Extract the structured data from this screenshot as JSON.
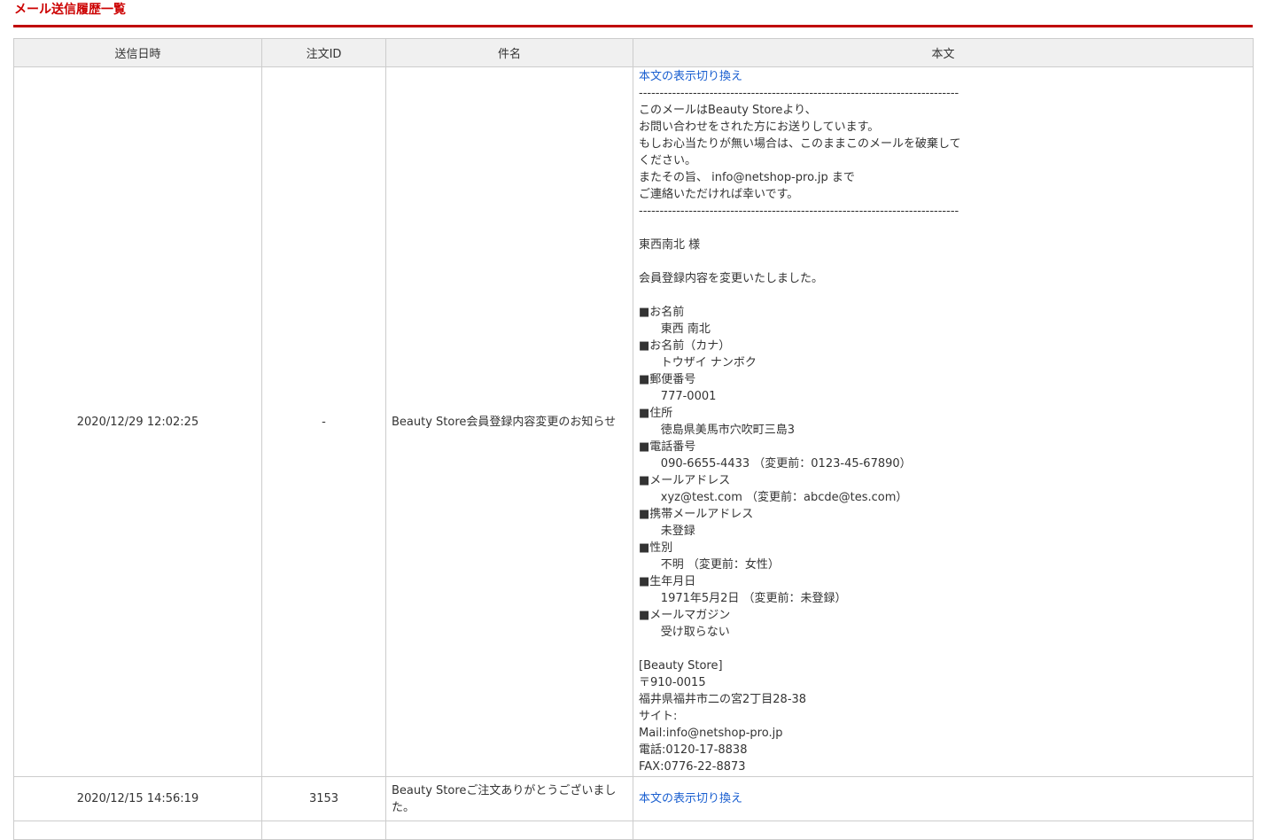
{
  "page": {
    "title": "メール送信履歴一覧"
  },
  "colors": {
    "accent": "#c00000",
    "link": "#1a5fd0",
    "header_bg": "#f0f0f0",
    "border": "#cccccc"
  },
  "table": {
    "headers": {
      "sent_at": "送信日時",
      "order_id": "注文ID",
      "subject": "件名",
      "body": "本文"
    },
    "rows": [
      {
        "sent_at": "2020/12/29 12:02:25",
        "order_id": "-",
        "subject": "Beauty Store会員登録内容変更のお知らせ",
        "toggle_label": "本文の表示切り換え",
        "body": "-----------------------------------------------------------------------------\nこのメールはBeauty Storeより、\nお問い合わせをされた方にお送りしています。\nもしお心当たりが無い場合は、このままこのメールを破棄して\nください。\nまたその旨、 info@netshop-pro.jp まで\nご連絡いただければ幸いです。\n-----------------------------------------------------------------------------\n\n東西南北 様\n\n会員登録内容を変更いたしました。\n\n■お名前\n      東西 南北\n■お名前（カナ）\n      トウザイ ナンボク\n■郵便番号\n      777-0001\n■住所\n      徳島県美馬市穴吹町三島3\n■電話番号\n      090-6655-4433 （変更前：0123-45-67890）\n■メールアドレス\n      xyz@test.com （変更前：abcde@tes.com）\n■携帯メールアドレス\n      未登録\n■性別\n      不明 （変更前：女性）\n■生年月日\n      1971年5月2日 （変更前：未登録）\n■メールマガジン\n      受け取らない\n\n[Beauty Store]\n〒910-0015\n福井県福井市二の宮2丁目28-38\nサイト:\nMail:info@netshop-pro.jp\n電話:0120-17-8838\nFAX:0776-22-8873"
      },
      {
        "sent_at": "2020/12/15 14:56:19",
        "order_id": "3153",
        "subject": "Beauty Storeご注文ありがとうございました。",
        "toggle_label": "本文の表示切り換え"
      }
    ]
  }
}
